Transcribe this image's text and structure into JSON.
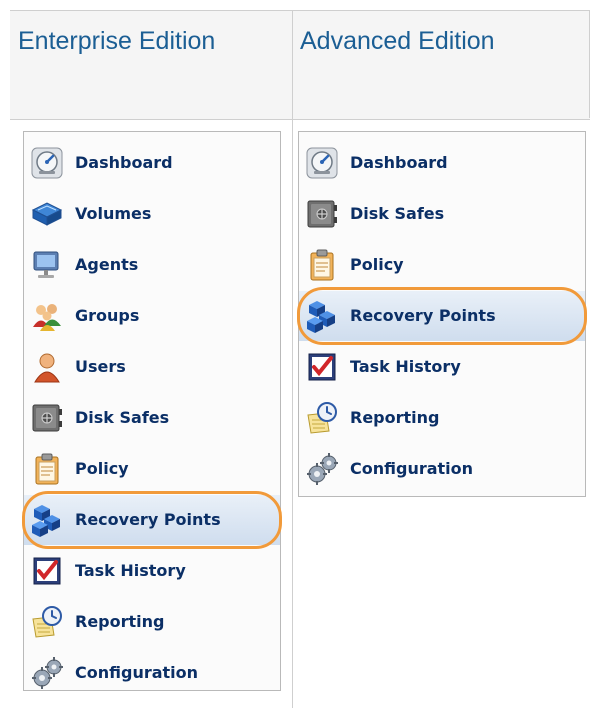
{
  "headers": {
    "enterprise": "Enterprise Edition",
    "advanced": "Advanced Edition"
  },
  "enterprise_menu": [
    {
      "label": "Dashboard",
      "icon": "dashboard-icon"
    },
    {
      "label": "Volumes",
      "icon": "volumes-icon"
    },
    {
      "label": "Agents",
      "icon": "agents-icon"
    },
    {
      "label": "Groups",
      "icon": "groups-icon"
    },
    {
      "label": "Users",
      "icon": "users-icon"
    },
    {
      "label": "Disk Safes",
      "icon": "disk-safe-icon"
    },
    {
      "label": "Policy",
      "icon": "policy-icon"
    },
    {
      "label": "Recovery Points",
      "icon": "recovery-points-icon",
      "highlighted": true
    },
    {
      "label": "Task History",
      "icon": "task-history-icon"
    },
    {
      "label": "Reporting",
      "icon": "reporting-icon"
    },
    {
      "label": "Configuration",
      "icon": "configuration-icon"
    }
  ],
  "advanced_menu": [
    {
      "label": "Dashboard",
      "icon": "dashboard-icon"
    },
    {
      "label": "Disk Safes",
      "icon": "disk-safe-icon"
    },
    {
      "label": "Policy",
      "icon": "policy-icon"
    },
    {
      "label": "Recovery Points",
      "icon": "recovery-points-icon",
      "highlighted": true
    },
    {
      "label": "Task History",
      "icon": "task-history-icon"
    },
    {
      "label": "Reporting",
      "icon": "reporting-icon"
    },
    {
      "label": "Configuration",
      "icon": "configuration-icon"
    }
  ],
  "colors": {
    "label": "#0b2f66",
    "header": "#1b5e94",
    "highlight_ring": "#f19a3a"
  }
}
